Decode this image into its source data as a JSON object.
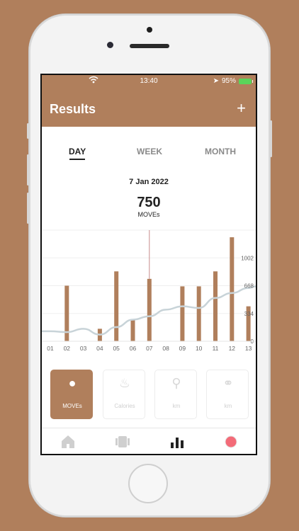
{
  "status": {
    "time": "13:40",
    "battery": "95%"
  },
  "header": {
    "title": "Results",
    "add_label": "+"
  },
  "tabs": [
    {
      "label": "DAY"
    },
    {
      "label": "WEEK"
    },
    {
      "label": "MONTH"
    }
  ],
  "summary": {
    "date": "7 Jan 2022",
    "value": "750",
    "unit": "MOVEs"
  },
  "chart_data": {
    "type": "bar",
    "categories": [
      "01",
      "02",
      "03",
      "04",
      "05",
      "06",
      "07",
      "08",
      "09",
      "10",
      "11",
      "12",
      "13"
    ],
    "values": [
      0,
      668,
      0,
      150,
      840,
      260,
      750,
      0,
      660,
      660,
      840,
      1250,
      420
    ],
    "line_values": [
      120,
      110,
      150,
      80,
      170,
      260,
      300,
      380,
      420,
      400,
      520,
      580,
      640
    ],
    "y_ticks": [
      "1002",
      "668",
      "334",
      "0"
    ],
    "ylim": [
      0,
      1336
    ],
    "selected_category": "07",
    "colors": {
      "bar": "#b07f5c",
      "line": "#c8d3d8",
      "marker": "#c78b8b",
      "grid": "#efefef"
    }
  },
  "metrics": [
    {
      "label": "MOVEs",
      "icon": "moves-icon"
    },
    {
      "label": "Calories",
      "icon": "flame-icon"
    },
    {
      "label": "km",
      "icon": "running-icon"
    },
    {
      "label": "km",
      "icon": "bicycle-icon"
    }
  ],
  "tabbar": [
    "home-icon",
    "activity-icon",
    "chart-icon",
    "record-icon"
  ],
  "colors": {
    "accent": "#b07f5c",
    "record": "#f36b78"
  }
}
